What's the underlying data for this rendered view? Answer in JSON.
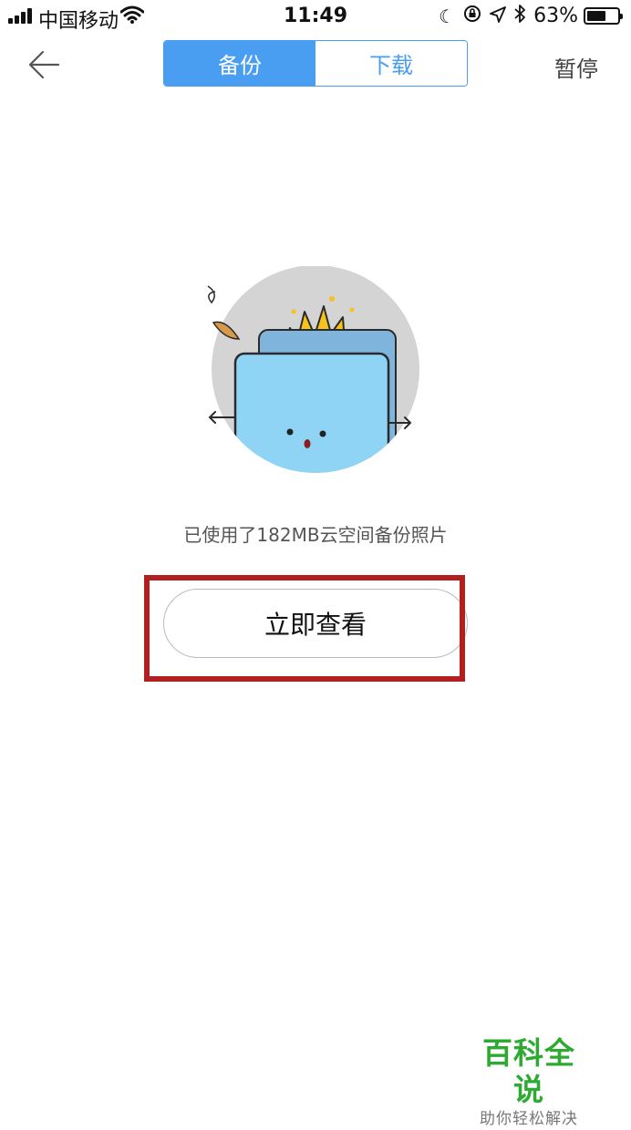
{
  "status_bar": {
    "carrier": "中国移动",
    "time": "11:49",
    "battery_percent": "63%",
    "battery_level": 0.63,
    "icons": [
      "signal-icon",
      "wifi-icon",
      "moon-icon",
      "orientation-lock-icon",
      "location-icon",
      "bluetooth-icon",
      "battery-icon"
    ]
  },
  "nav": {
    "back_icon": "back-arrow-icon",
    "tabs": [
      {
        "label": "备份",
        "active": true
      },
      {
        "label": "下载",
        "active": false
      }
    ],
    "pause_label": "暂停"
  },
  "main": {
    "illustration": "toaster-burnt-toast-illustration",
    "message": "已使用了182MB云空间备份照片",
    "view_button_label": "立即查看"
  },
  "watermark": {
    "title": "百科全说",
    "subtitle": "助你轻松解决"
  },
  "colors": {
    "accent": "#4a9ef2",
    "highlight": "#b0201f",
    "watermark_green": "#2eaa32"
  }
}
